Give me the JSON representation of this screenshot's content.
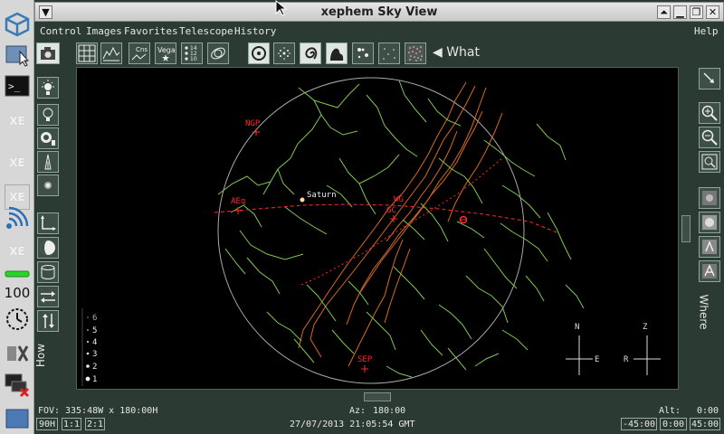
{
  "window": {
    "title": "xephem Sky View"
  },
  "menu": {
    "items": [
      "Control",
      "Images",
      "Favorites",
      "Telescope",
      "History"
    ],
    "help": "Help"
  },
  "toolbar": {
    "what_label": "What",
    "cns_icon_text": "Cns",
    "vega_icon_text": "Vega",
    "mag_icon_text": [
      "14",
      "12",
      "10"
    ]
  },
  "side": {
    "how_label": "How",
    "where_label": "Where"
  },
  "launcher": {
    "battery_level": "100",
    "xe_labels": [
      "XE",
      "XE",
      "XE",
      "XE"
    ]
  },
  "sky": {
    "labels": {
      "ngp": "NGP",
      "saturn": "Saturn",
      "aeq": "AEq",
      "wg": "WG",
      "gc": "GC",
      "sep": "SEP"
    },
    "mag_legend": [
      "6",
      "5",
      "4",
      "3",
      "2",
      "1"
    ],
    "compass1": {
      "n": "N",
      "e": "E"
    },
    "compass2": {
      "z": "Z",
      "r": "R"
    }
  },
  "status": {
    "fov": "FOV:",
    "fov_value": "335:48W x 180:00H",
    "az": "Az:",
    "az_value": "180:00",
    "alt": "Alt:",
    "alt_value": "0:00",
    "datetime": "27/07/2013 21:05:54 GMT",
    "btn_90h": "90H",
    "btn_11": "1:1",
    "btn_21": "2:1",
    "range": [
      "-45:00",
      "0:00",
      "45:00"
    ]
  },
  "colors": {
    "constellation": "#7ec850",
    "milkyway": "#d86a22",
    "red": "#ff2a2a",
    "frame": "#2c3a34"
  }
}
